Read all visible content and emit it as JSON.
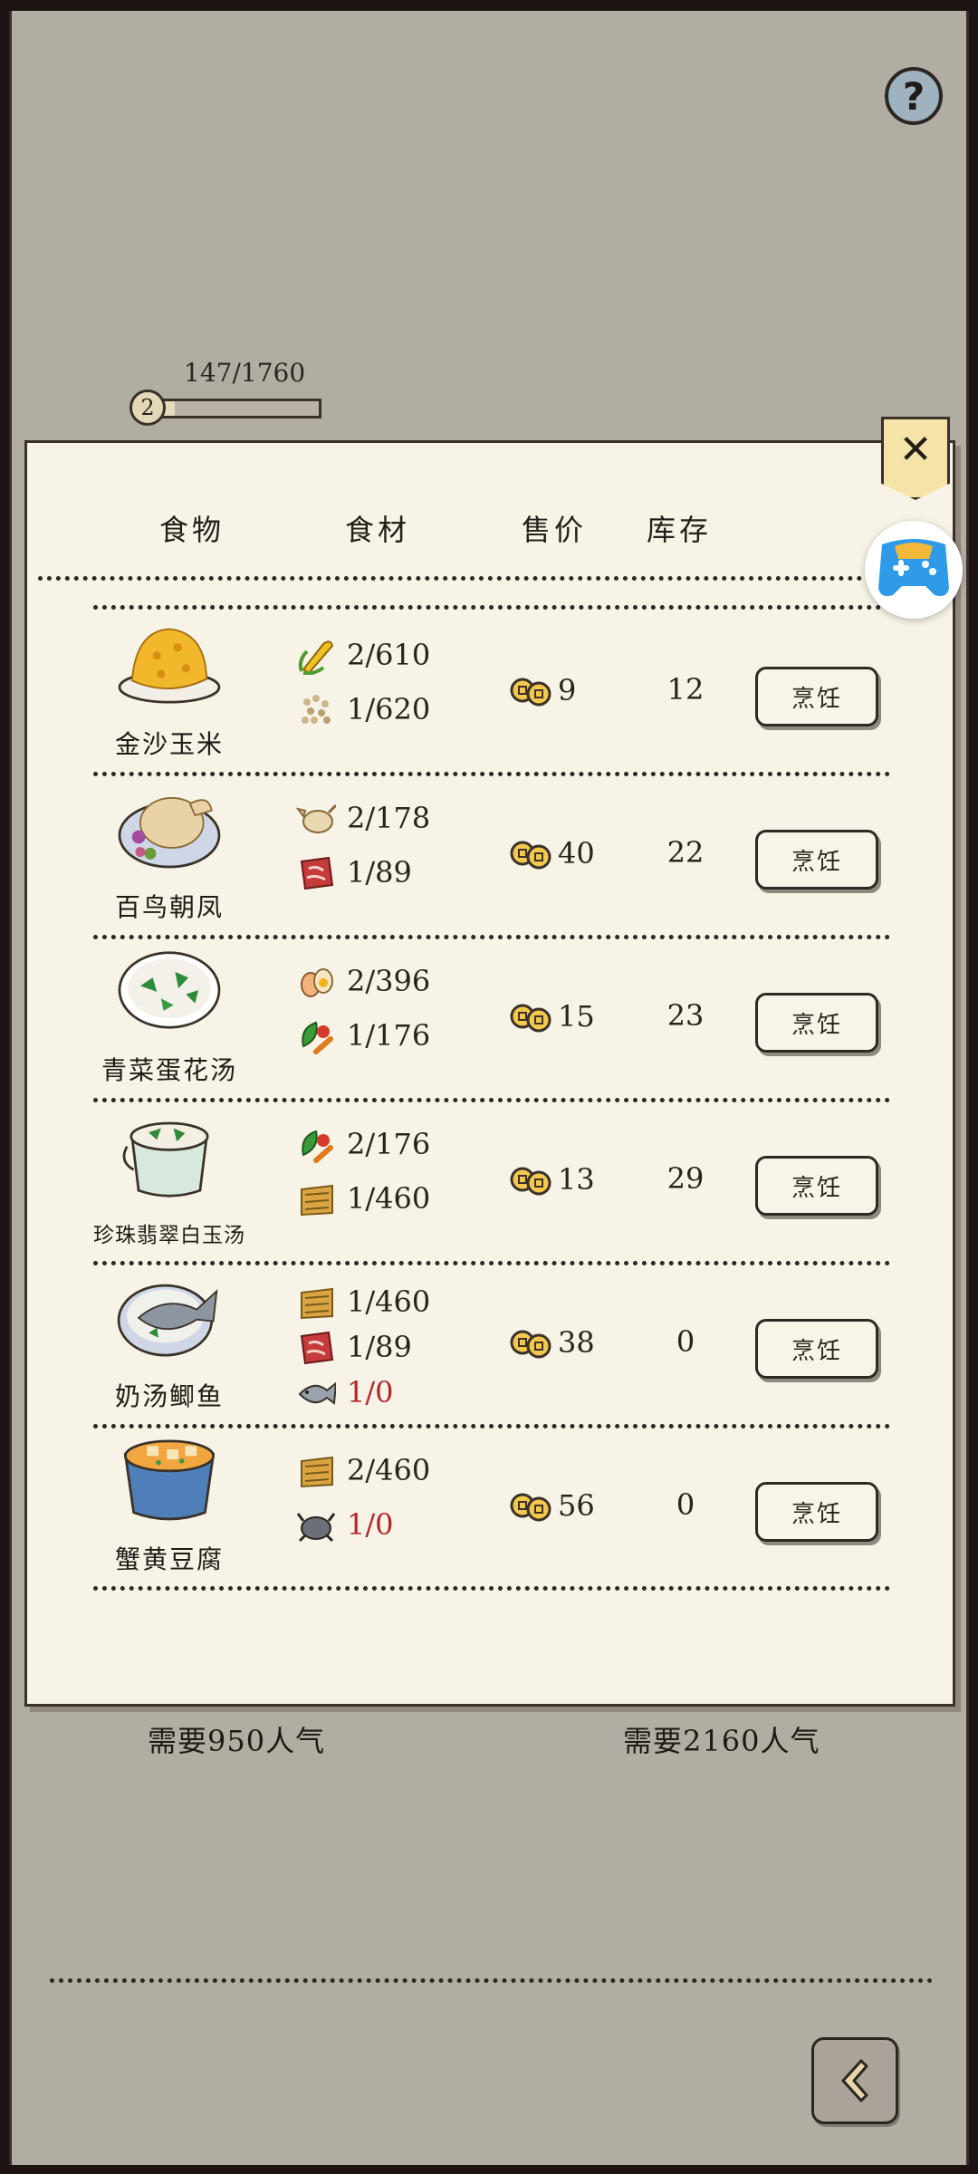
{
  "header": {
    "help_label": "?",
    "level": "2",
    "progress_text": "147/1760",
    "progress_fraction": 0.0835
  },
  "table": {
    "columns": [
      "食物",
      "食材",
      "售价",
      "库存"
    ],
    "rows": [
      {
        "name": "金沙玉米",
        "dish_icon": "golden-corn-dish-icon",
        "ingredients": [
          {
            "icon": "corn-icon",
            "amount": "2/610",
            "short": false
          },
          {
            "icon": "grain-icon",
            "amount": "1/620",
            "short": false
          }
        ],
        "price": "9",
        "stock": "12",
        "cook_label": "烹饪"
      },
      {
        "name": "百鸟朝凤",
        "dish_icon": "roast-chicken-dish-icon",
        "ingredients": [
          {
            "icon": "chicken-icon",
            "amount": "2/178",
            "short": false
          },
          {
            "icon": "meat-icon",
            "amount": "1/89",
            "short": false
          }
        ],
        "price": "40",
        "stock": "22",
        "cook_label": "烹饪"
      },
      {
        "name": "青菜蛋花汤",
        "dish_icon": "egg-veggie-soup-icon",
        "ingredients": [
          {
            "icon": "egg-icon",
            "amount": "2/396",
            "short": false
          },
          {
            "icon": "vegetable-icon",
            "amount": "1/176",
            "short": false
          }
        ],
        "price": "15",
        "stock": "23",
        "cook_label": "烹饪"
      },
      {
        "name": "珍珠翡翠白玉汤",
        "dish_icon": "jade-tofu-soup-icon",
        "ingredients": [
          {
            "icon": "vegetable-icon",
            "amount": "2/176",
            "short": false
          },
          {
            "icon": "grain-sack-icon",
            "amount": "1/460",
            "short": false
          }
        ],
        "price": "13",
        "stock": "29",
        "cook_label": "烹饪"
      },
      {
        "name": "奶汤鲫鱼",
        "dish_icon": "fish-soup-icon",
        "ingredients": [
          {
            "icon": "grain-sack-icon",
            "amount": "1/460",
            "short": false
          },
          {
            "icon": "meat-icon",
            "amount": "1/89",
            "short": false
          },
          {
            "icon": "fish-icon",
            "amount": "1/0",
            "short": true
          }
        ],
        "price": "38",
        "stock": "0",
        "cook_label": "烹饪"
      },
      {
        "name": "蟹黄豆腐",
        "dish_icon": "crab-tofu-dish-icon",
        "ingredients": [
          {
            "icon": "grain-sack-icon",
            "amount": "2/460",
            "short": false
          },
          {
            "icon": "crab-icon",
            "amount": "1/0",
            "short": true
          }
        ],
        "price": "56",
        "stock": "0",
        "cook_label": "烹饪"
      }
    ]
  },
  "requirements": [
    "需要950人气",
    "需要2160人气"
  ],
  "colors": {
    "background": "#b2ada3",
    "panel": "#f7f3e6",
    "shortage": "#b3262c",
    "close_tab": "#f5e3a8"
  }
}
